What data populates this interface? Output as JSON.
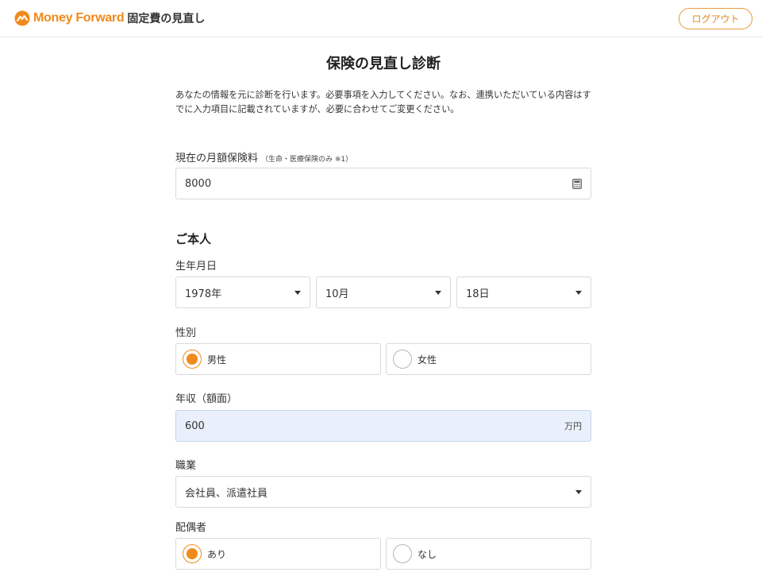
{
  "header": {
    "brand": "Money Forward",
    "service": "固定費の見直し",
    "logout_label": "ログアウト"
  },
  "page": {
    "title": "保険の見直し診断",
    "intro": "あなたの情報を元に診断を行います。必要事項を入力してください。なお、連携いただいている内容はすでに入力項目に記載されていますが、必要に合わせてご変更ください。"
  },
  "premium": {
    "label": "現在の月額保険料",
    "note": "（生命・医療保険のみ ※1）",
    "value": "8000",
    "icon": "calculator-icon"
  },
  "self_section": {
    "heading": "ご本人",
    "birthdate": {
      "label": "生年月日",
      "year": "1978年",
      "month": "10月",
      "day": "18日"
    },
    "gender": {
      "label": "性別",
      "options": [
        "男性",
        "女性"
      ],
      "selected": "男性"
    },
    "income": {
      "label": "年収（額面）",
      "value": "600",
      "unit": "万円"
    },
    "occupation": {
      "label": "職業",
      "value": "会社員、派遣社員"
    },
    "spouse": {
      "label": "配偶者",
      "options": [
        "あり",
        "なし"
      ],
      "selected": "あり"
    }
  },
  "colors": {
    "accent": "#f08a1c",
    "highlight_field": "#e9f0fb",
    "border": "#d9d9d9"
  }
}
